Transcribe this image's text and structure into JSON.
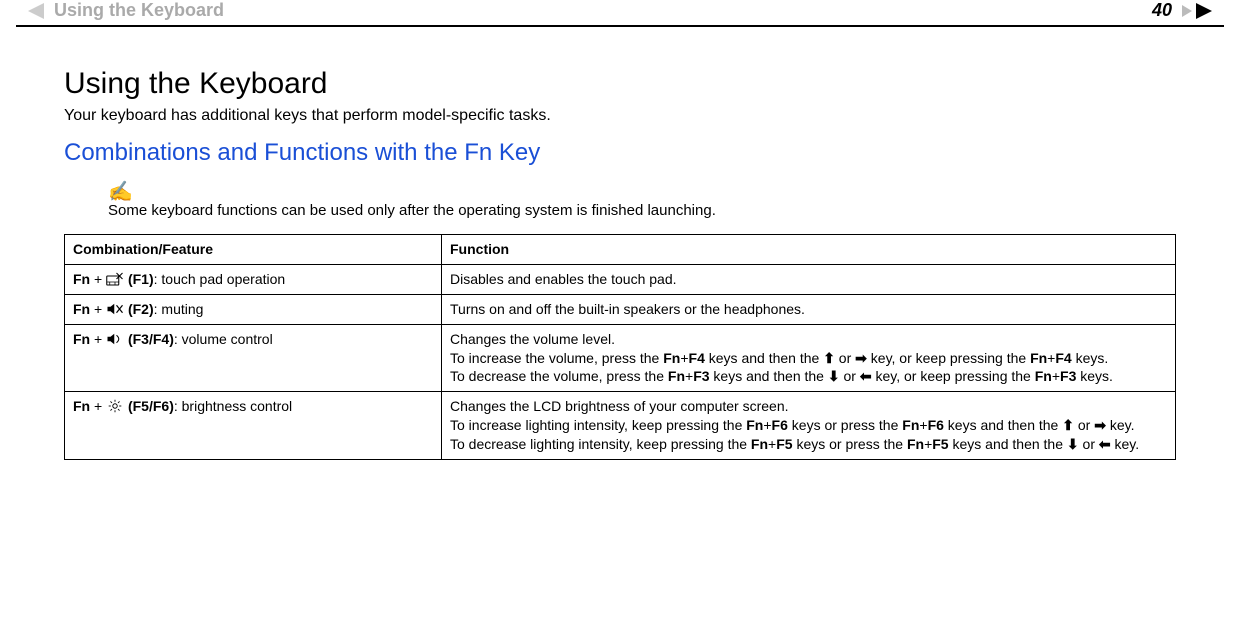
{
  "header": {
    "breadcrumb": "Using the Keyboard",
    "page_number": "40"
  },
  "title": "Using the Keyboard",
  "intro": "Your keyboard has additional keys that perform model-specific tasks.",
  "section_heading": "Combinations and Functions with the Fn Key",
  "note": "Some keyboard functions can be used only after the operating system is finished launching.",
  "table": {
    "headers": {
      "col1": "Combination/Feature",
      "col2": "Function"
    },
    "rows": [
      {
        "combo_prefix": "Fn",
        "icon": "touchpad-off-icon",
        "key_label": "(F1)",
        "combo_suffix": ": touch pad operation",
        "function_parts": [
          {
            "t": "plain",
            "v": "Disables and enables the touch pad."
          }
        ]
      },
      {
        "combo_prefix": "Fn",
        "icon": "mute-icon",
        "key_label": "(F2)",
        "combo_suffix": ": muting",
        "function_parts": [
          {
            "t": "plain",
            "v": "Turns on and off the built-in speakers or the headphones."
          }
        ]
      },
      {
        "combo_prefix": "Fn",
        "icon": "volume-icon",
        "key_label": "(F3/F4)",
        "combo_suffix": ": volume control",
        "function_parts": [
          {
            "t": "plain",
            "v": "Changes the volume level."
          },
          {
            "t": "br"
          },
          {
            "t": "plain",
            "v": "To increase the volume, press the "
          },
          {
            "t": "bold",
            "v": "Fn"
          },
          {
            "t": "plain",
            "v": "+"
          },
          {
            "t": "bold",
            "v": "F4"
          },
          {
            "t": "plain",
            "v": " keys and then the "
          },
          {
            "t": "arrow",
            "v": "up"
          },
          {
            "t": "plain",
            "v": " or "
          },
          {
            "t": "arrow",
            "v": "right"
          },
          {
            "t": "plain",
            "v": " key, or keep pressing the "
          },
          {
            "t": "bold",
            "v": "Fn"
          },
          {
            "t": "plain",
            "v": "+"
          },
          {
            "t": "bold",
            "v": "F4"
          },
          {
            "t": "plain",
            "v": " keys."
          },
          {
            "t": "br"
          },
          {
            "t": "plain",
            "v": "To decrease the volume, press the "
          },
          {
            "t": "bold",
            "v": "Fn"
          },
          {
            "t": "plain",
            "v": "+"
          },
          {
            "t": "bold",
            "v": "F3"
          },
          {
            "t": "plain",
            "v": " keys and then the "
          },
          {
            "t": "arrow",
            "v": "down"
          },
          {
            "t": "plain",
            "v": " or "
          },
          {
            "t": "arrow",
            "v": "left"
          },
          {
            "t": "plain",
            "v": " key, or keep pressing the "
          },
          {
            "t": "bold",
            "v": "Fn"
          },
          {
            "t": "plain",
            "v": "+"
          },
          {
            "t": "bold",
            "v": "F3"
          },
          {
            "t": "plain",
            "v": " keys."
          }
        ]
      },
      {
        "combo_prefix": "Fn",
        "icon": "brightness-icon",
        "key_label": "(F5/F6)",
        "combo_suffix": ": brightness control",
        "function_parts": [
          {
            "t": "plain",
            "v": "Changes the LCD brightness of your computer screen."
          },
          {
            "t": "br"
          },
          {
            "t": "plain",
            "v": "To increase lighting intensity, keep pressing the "
          },
          {
            "t": "bold",
            "v": "Fn"
          },
          {
            "t": "plain",
            "v": "+"
          },
          {
            "t": "bold",
            "v": "F6"
          },
          {
            "t": "plain",
            "v": " keys or press the "
          },
          {
            "t": "bold",
            "v": "Fn"
          },
          {
            "t": "plain",
            "v": "+"
          },
          {
            "t": "bold",
            "v": "F6"
          },
          {
            "t": "plain",
            "v": " keys and then the "
          },
          {
            "t": "arrow",
            "v": "up"
          },
          {
            "t": "plain",
            "v": " or "
          },
          {
            "t": "arrow",
            "v": "right"
          },
          {
            "t": "plain",
            "v": " key."
          },
          {
            "t": "br"
          },
          {
            "t": "plain",
            "v": "To decrease lighting intensity, keep pressing the "
          },
          {
            "t": "bold",
            "v": "Fn"
          },
          {
            "t": "plain",
            "v": "+"
          },
          {
            "t": "bold",
            "v": "F5"
          },
          {
            "t": "plain",
            "v": " keys or press the "
          },
          {
            "t": "bold",
            "v": "Fn"
          },
          {
            "t": "plain",
            "v": "+"
          },
          {
            "t": "bold",
            "v": "F5"
          },
          {
            "t": "plain",
            "v": " keys and then the "
          },
          {
            "t": "arrow",
            "v": "down"
          },
          {
            "t": "plain",
            "v": " or "
          },
          {
            "t": "arrow",
            "v": "left"
          },
          {
            "t": "plain",
            "v": " key."
          }
        ]
      }
    ]
  }
}
